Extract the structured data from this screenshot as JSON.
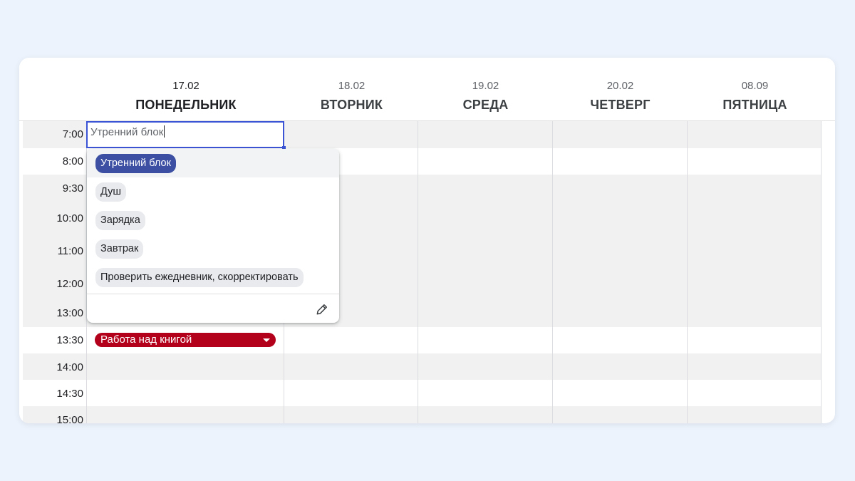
{
  "days": [
    {
      "date": "17.02",
      "name": "ПОНЕДЕЛЬНИК"
    },
    {
      "date": "18.02",
      "name": "ВТОРНИК"
    },
    {
      "date": "19.02",
      "name": "СРЕДА"
    },
    {
      "date": "20.02",
      "name": "ЧЕТВЕРГ"
    },
    {
      "date": "08.09",
      "name": "ПЯТНИЦА"
    }
  ],
  "times": [
    "7:00",
    "8:00",
    "9:30",
    "10:00",
    "11:00",
    "12:00",
    "13:00",
    "13:30",
    "14:00",
    "14:30",
    "15:00"
  ],
  "active_cell": {
    "value": "Утренний блок"
  },
  "dropdown": {
    "options": [
      "Утренний блок",
      "Душ",
      "Зарядка",
      "Завтрак",
      "Проверить ежедневник, скорректировать"
    ],
    "selected": "Утренний блок",
    "edit_icon": "pencil-icon"
  },
  "event": {
    "label": "Работа над книгой",
    "color": "#b3001b",
    "icon": "dropdown-arrow-icon"
  },
  "colors": {
    "background": "#edf3fc",
    "selection": "#3b54d6",
    "selected_chip": "#3c4fa3"
  }
}
